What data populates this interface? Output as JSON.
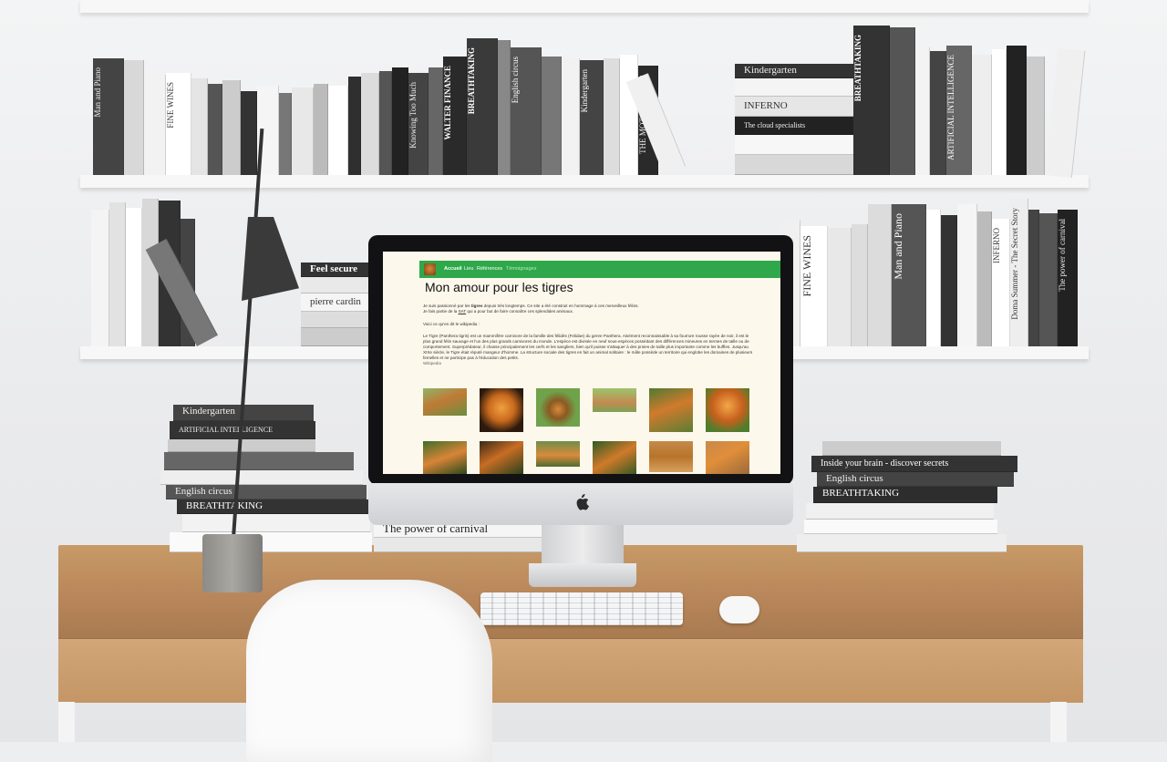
{
  "background_books": {
    "top_shelf_spines": [
      "Man and Piano",
      "FINE WINES",
      "WALTER FINANCE",
      "BREATHTAKING",
      "English circus",
      "Kindergarten",
      "THE MOTOR MAKER",
      "INFERNO",
      "ARTIFICIAL INTELLIGENCE",
      "Knowing Too Much"
    ],
    "top_shelf_stack": [
      "Kindergarten",
      "INFERNO",
      "The cloud specialists"
    ],
    "mid_shelf_spines": [
      "FINE WINES",
      "Man and Piano",
      "INFERNO",
      "The power of carnival",
      "Doma Summer - The Secret Story"
    ],
    "mid_shelf_stack": [
      "Feel secure",
      "pierre cardin"
    ],
    "desk_stack_left": [
      "Kindergarten",
      "ARTIFICIAL INTELLIGENCE",
      "English circus",
      "BREATHTAKING",
      "The power of carnival"
    ],
    "desk_stack_right": [
      "Inside your brain - discover secrets",
      "English circus",
      "BREATHTAKING"
    ]
  },
  "website": {
    "nav": {
      "items": [
        "Accueil",
        "Lieu",
        "Références",
        "Témoignages"
      ]
    },
    "title": "Mon amour pour les tigres",
    "intro_line1_pre": "Je suis passionné par les ",
    "intro_bold": "tigres",
    "intro_line1_post": " depuis très longtemps. Ce site a été construit en hommage à ces merveilleux félins.",
    "intro_line2_pre": "Je fais partie de la ",
    "intro_link": "SAT",
    "intro_line2_post": " qui a pour but de faire connaître ces splendides animaux.",
    "wiki_intro": "Voici ce qu'en dit le wikipedia :",
    "wiki_text": "Le Tigre (Panthera tigris) est un mammifère carnivore de la famille des félidés (Felidae) du genre Panthera. Aisément reconnaissable à sa fourrure rousse rayée de noir, il est le plus grand félin sauvage et l'un des plus grands carnivores du monde. L'espèce est divisée en neuf sous-espèces possédant des différences mineures en termes de taille ou de comportement. Superprédateur, il chasse principalement les cerfs et les sangliers, bien qu'il puisse s'attaquer à des proies de taille plus importante comme les buffles. Jusqu'au XIXe siècle, le Tigre était réputé mangeur d'homme. La structure sociale des tigres en fait un animal solitaire : le mâle possède un territoire qui englobe les domaines de plusieurs femelles et ne participe pas à l'éducation des petits.",
    "wiki_source": "Wikipedia",
    "gallery_count_visible": 12
  },
  "colors": {
    "nav_green": "#2ea84a",
    "screen_bg": "#fdf8ec",
    "desk_wood": "#c49666"
  }
}
